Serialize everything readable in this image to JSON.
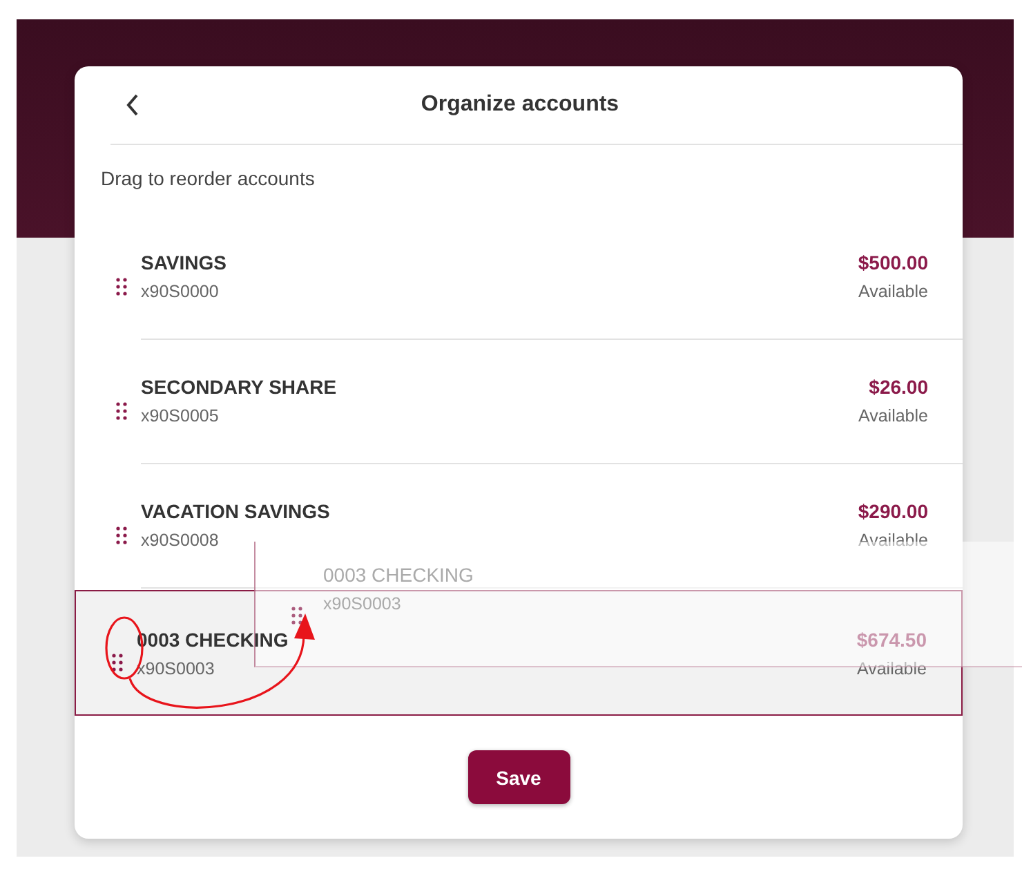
{
  "dialog": {
    "title": "Organize accounts",
    "instruction": "Drag to reorder accounts"
  },
  "accounts": [
    {
      "name": "SAVINGS",
      "number": "x90S0000",
      "amount": "$500.00",
      "balance_label": "Available",
      "selected": false
    },
    {
      "name": "SECONDARY SHARE",
      "number": "x90S0005",
      "amount": "$26.00",
      "balance_label": "Available",
      "selected": false
    },
    {
      "name": "VACATION SAVINGS",
      "number": "x90S0008",
      "amount": "$290.00",
      "balance_label": "Available",
      "selected": false
    },
    {
      "name": "0003 CHECKING",
      "number": "x90S0003",
      "amount": "$674.50",
      "balance_label": "Available",
      "selected": true
    }
  ],
  "drag_preview": {
    "name": "0003 CHECKING",
    "number": "x90S0003"
  },
  "buttons": {
    "save": "Save"
  }
}
